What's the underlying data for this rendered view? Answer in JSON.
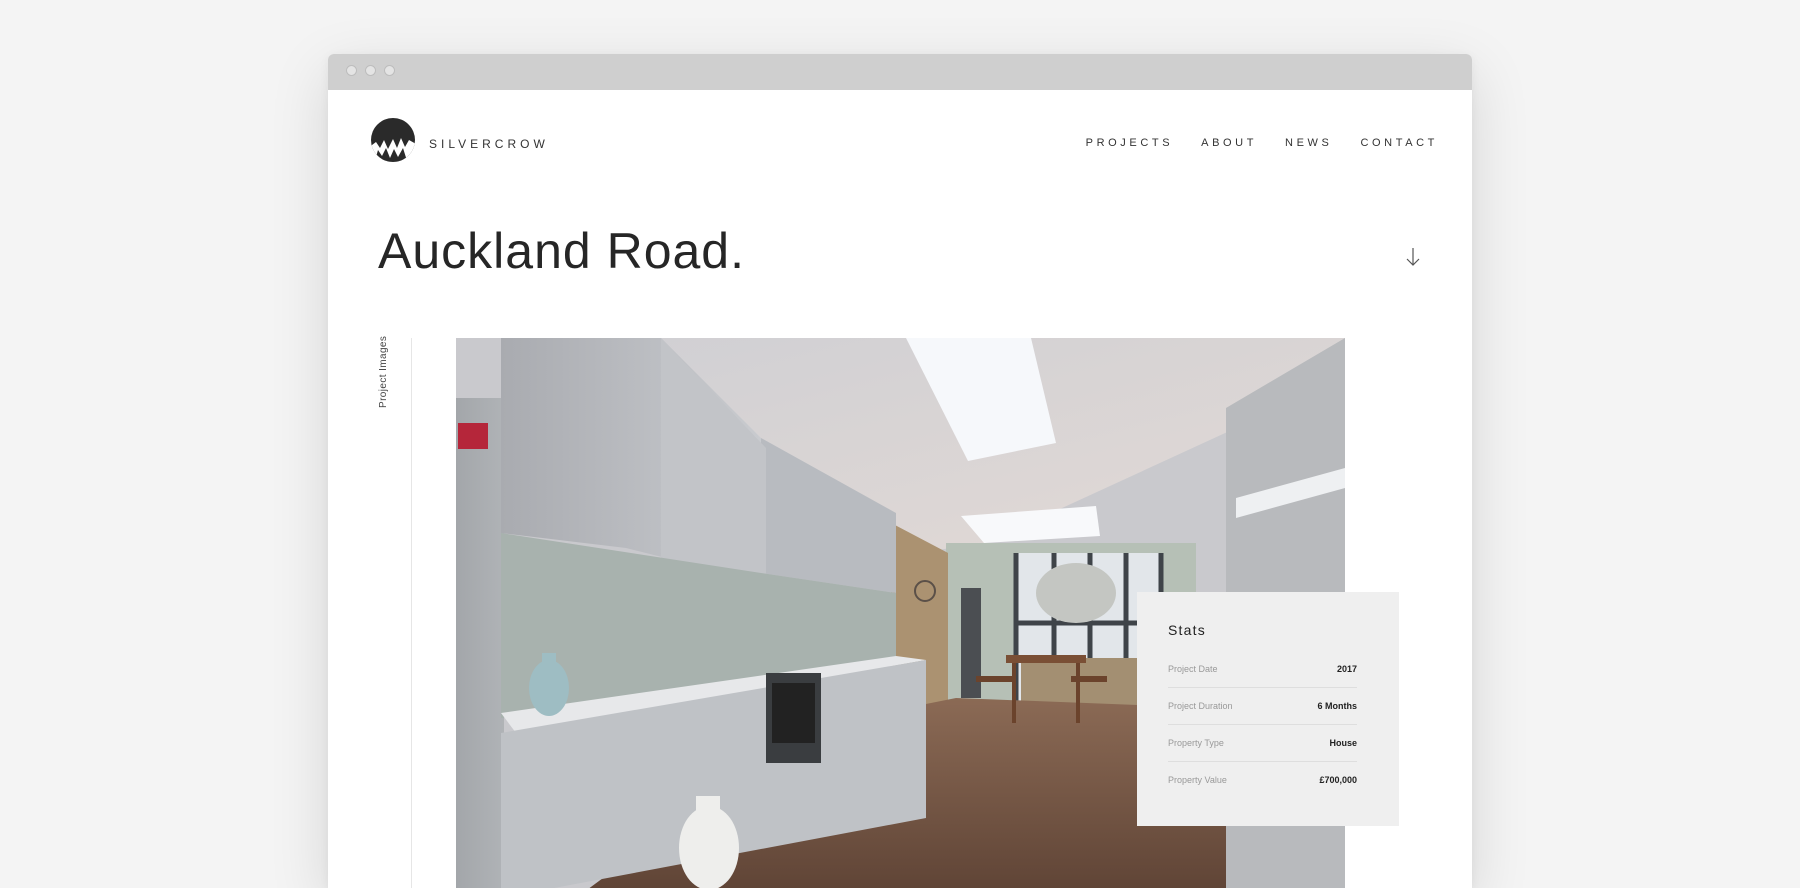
{
  "brand": {
    "name": "SILVERCROW"
  },
  "nav": [
    {
      "label": "PROJECTS"
    },
    {
      "label": "ABOUT"
    },
    {
      "label": "NEWS"
    },
    {
      "label": "CONTACT"
    }
  ],
  "page": {
    "title": "Auckland Road."
  },
  "gallery": {
    "label": "Project Images",
    "image": "kitchen-interior-photo"
  },
  "stats": {
    "title": "Stats",
    "rows": [
      {
        "label": "Project Date",
        "value": "2017"
      },
      {
        "label": "Project Duration",
        "value": "6 Months"
      },
      {
        "label": "Property Type",
        "value": "House"
      },
      {
        "label": "Property Value",
        "value": "£700,000"
      }
    ]
  },
  "icons": {
    "logo": "crow-moon-logo-icon",
    "scroll": "arrow-down-icon"
  },
  "colors": {
    "background": "#f4f4f4",
    "titlebar": "#cfcfcf",
    "text": "#2b2b2b",
    "stats_panel": "#efefef"
  }
}
